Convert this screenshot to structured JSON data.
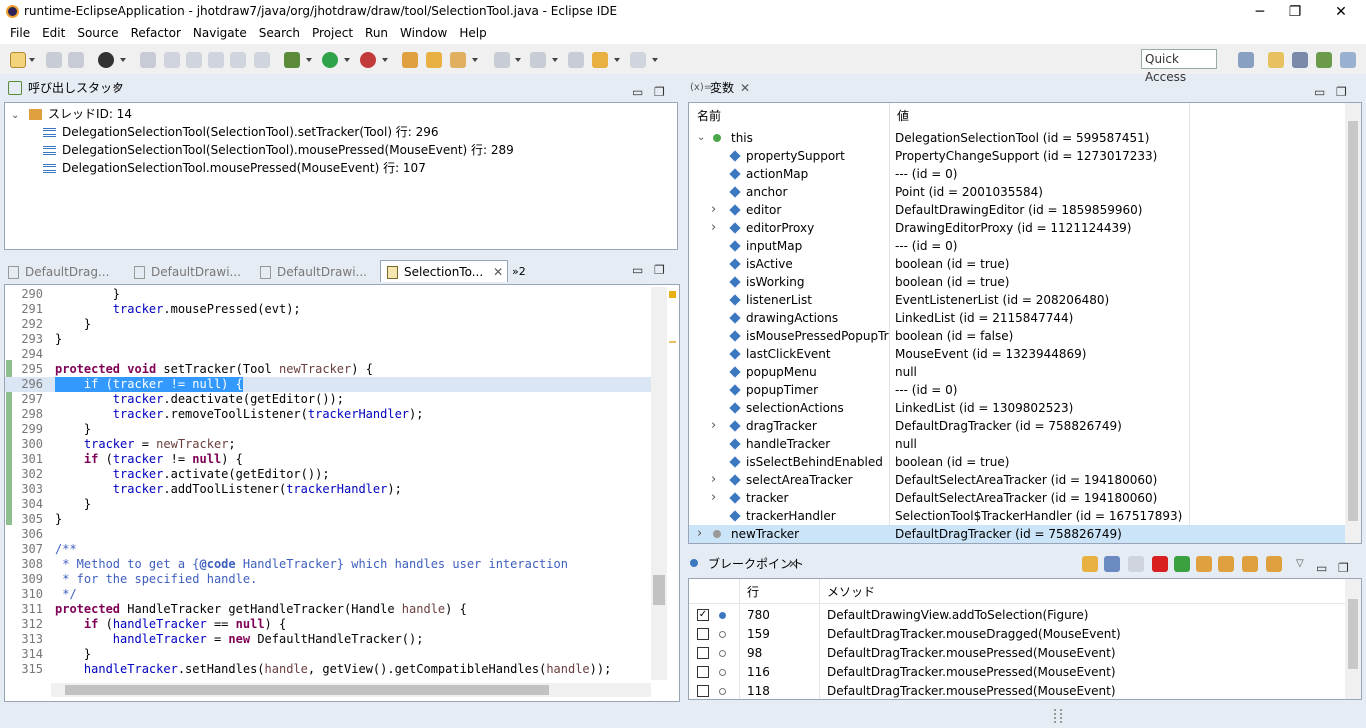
{
  "window": {
    "title": "runtime-EclipseApplication - jhotdraw7/java/org/jhotdraw/draw/tool/SelectionTool.java - Eclipse IDE",
    "min": "─",
    "max": "❐",
    "close": "✕"
  },
  "menu": [
    "File",
    "Edit",
    "Source",
    "Refactor",
    "Navigate",
    "Search",
    "Project",
    "Run",
    "Window",
    "Help"
  ],
  "quick_access": "Quick Access",
  "callstack": {
    "tab": "呼び出しスタック",
    "thread": "スレッドID: 14",
    "frames": [
      "DelegationSelectionTool(SelectionTool).setTracker(Tool) 行: 296",
      "DelegationSelectionTool(SelectionTool).mousePressed(MouseEvent) 行: 289",
      "DelegationSelectionTool.mousePressed(MouseEvent) 行: 107"
    ]
  },
  "editor": {
    "tabs": [
      "DefaultDrag...",
      "DefaultDrawi...",
      "DefaultDrawi...",
      "SelectionTo..."
    ],
    "overflow": "»2",
    "lines": [
      {
        "n": "290",
        "t": "        }"
      },
      {
        "n": "291",
        "t": "        tracker.mousePressed(evt);"
      },
      {
        "n": "292",
        "t": "    }"
      },
      {
        "n": "293",
        "t": "}"
      },
      {
        "n": "294",
        "t": ""
      },
      {
        "n": "295",
        "t": "protected void setTracker(Tool newTracker) {"
      },
      {
        "n": "296",
        "t": "    if (tracker != null) {"
      },
      {
        "n": "297",
        "t": "        tracker.deactivate(getEditor());"
      },
      {
        "n": "298",
        "t": "        tracker.removeToolListener(trackerHandler);"
      },
      {
        "n": "299",
        "t": "    }"
      },
      {
        "n": "300",
        "t": "    tracker = newTracker;"
      },
      {
        "n": "301",
        "t": "    if (tracker != null) {"
      },
      {
        "n": "302",
        "t": "        tracker.activate(getEditor());"
      },
      {
        "n": "303",
        "t": "        tracker.addToolListener(trackerHandler);"
      },
      {
        "n": "304",
        "t": "    }"
      },
      {
        "n": "305",
        "t": "}"
      },
      {
        "n": "306",
        "t": ""
      },
      {
        "n": "307",
        "t": "/**"
      },
      {
        "n": "308",
        "t": " * Method to get a {@code HandleTracker} which handles user interaction"
      },
      {
        "n": "309",
        "t": " * for the specified handle."
      },
      {
        "n": "310",
        "t": " */"
      },
      {
        "n": "311",
        "t": "protected HandleTracker getHandleTracker(Handle handle) {"
      },
      {
        "n": "312",
        "t": "    if (handleTracker == null) {"
      },
      {
        "n": "313",
        "t": "        handleTracker = new DefaultHandleTracker();"
      },
      {
        "n": "314",
        "t": "    }"
      },
      {
        "n": "315",
        "t": "    handleTracker.setHandles(handle, getView().getCompatibleHandles(handle));"
      }
    ]
  },
  "variables": {
    "tab": "変数",
    "col_name": "名前",
    "col_value": "値",
    "rows": [
      {
        "name": "this",
        "value": "DelegationSelectionTool (id = 599587451)"
      },
      {
        "name": "propertySupport",
        "value": "PropertyChangeSupport (id = 1273017233)"
      },
      {
        "name": "actionMap",
        "value": "--- (id = 0)"
      },
      {
        "name": "anchor",
        "value": "Point (id = 2001035584)"
      },
      {
        "name": "editor",
        "value": "DefaultDrawingEditor (id = 1859859960)"
      },
      {
        "name": "editorProxy",
        "value": "DrawingEditorProxy (id = 1121124439)"
      },
      {
        "name": "inputMap",
        "value": "--- (id = 0)"
      },
      {
        "name": "isActive",
        "value": "boolean (id = true)"
      },
      {
        "name": "isWorking",
        "value": "boolean (id = true)"
      },
      {
        "name": "listenerList",
        "value": "EventListenerList (id = 208206480)"
      },
      {
        "name": "drawingActions",
        "value": "LinkedList (id = 2115847744)"
      },
      {
        "name": "isMousePressedPopupTrigg",
        "value": "boolean (id = false)"
      },
      {
        "name": "lastClickEvent",
        "value": "MouseEvent (id = 1323944869)"
      },
      {
        "name": "popupMenu",
        "value": "null"
      },
      {
        "name": "popupTimer",
        "value": "--- (id = 0)"
      },
      {
        "name": "selectionActions",
        "value": "LinkedList (id = 1309802523)"
      },
      {
        "name": "dragTracker",
        "value": "DefaultDragTracker (id = 758826749)"
      },
      {
        "name": "handleTracker",
        "value": "null"
      },
      {
        "name": "isSelectBehindEnabled",
        "value": "boolean (id = true)"
      },
      {
        "name": "selectAreaTracker",
        "value": "DefaultSelectAreaTracker (id = 194180060)"
      },
      {
        "name": "tracker",
        "value": "DefaultSelectAreaTracker (id = 194180060)"
      },
      {
        "name": "trackerHandler",
        "value": "SelectionTool$TrackerHandler (id = 167517893)"
      },
      {
        "name": "newTracker",
        "value": "DefaultDragTracker (id = 758826749)"
      }
    ]
  },
  "breakpoints": {
    "tab": "ブレークポイント",
    "col_line": "行",
    "col_method": "メソッド",
    "rows": [
      {
        "line": "780",
        "method": "DefaultDrawingView.addToSelection(Figure)"
      },
      {
        "line": "159",
        "method": "DefaultDragTracker.mouseDragged(MouseEvent)"
      },
      {
        "line": "98",
        "method": "DefaultDragTracker.mousePressed(MouseEvent)"
      },
      {
        "line": "116",
        "method": "DefaultDragTracker.mousePressed(MouseEvent)"
      },
      {
        "line": "118",
        "method": "DefaultDragTracker.mousePressed(MouseEvent)"
      }
    ]
  }
}
